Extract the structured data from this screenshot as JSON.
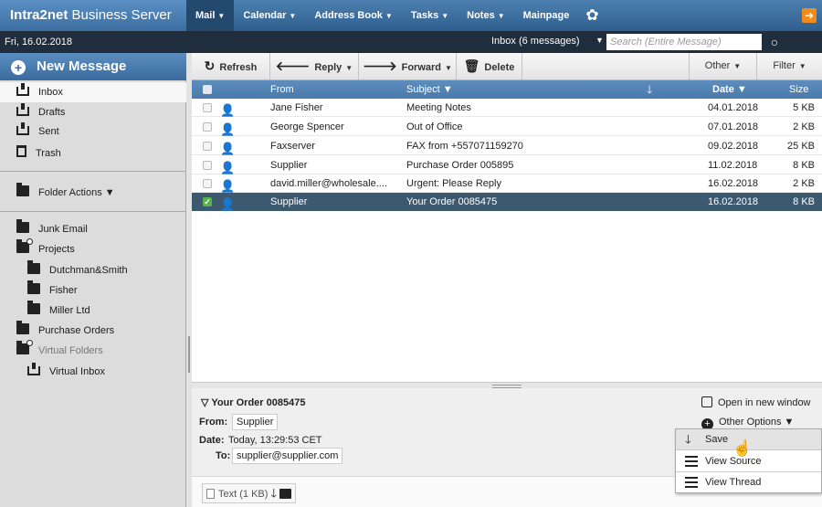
{
  "brand": {
    "bold": "Intra2net",
    "light": " Business Server"
  },
  "nav": {
    "items": [
      {
        "label": "Mail",
        "caret": "▼"
      },
      {
        "label": "Calendar",
        "caret": "▼"
      },
      {
        "label": "Address Book",
        "caret": "▼"
      },
      {
        "label": "Tasks",
        "caret": "▼"
      },
      {
        "label": "Notes",
        "caret": "▼"
      },
      {
        "label": "Mainpage",
        "caret": ""
      }
    ]
  },
  "subbar": {
    "date": "Fri, 16.02.2018",
    "inbox_count": "Inbox (6 messages)",
    "search_placeholder": "Search (Entire Message)"
  },
  "sidebar": {
    "new_message": "New Message",
    "folders": [
      {
        "label": "Inbox"
      },
      {
        "label": "Drafts"
      },
      {
        "label": "Sent"
      },
      {
        "label": "Trash"
      }
    ],
    "folder_actions": "Folder Actions ▼",
    "more": [
      {
        "label": "Junk Email"
      },
      {
        "label": "Projects"
      },
      {
        "label": "Dutchman&Smith"
      },
      {
        "label": "Fisher"
      },
      {
        "label": "Miller Ltd"
      },
      {
        "label": "Purchase Orders"
      },
      {
        "label": "Virtual Folders"
      },
      {
        "label": "Virtual Inbox"
      }
    ]
  },
  "toolbar": {
    "refresh": "Refresh",
    "reply": "Reply",
    "forward": "Forward",
    "delete": "Delete",
    "other": "Other",
    "filter": "Filter"
  },
  "list": {
    "headers": {
      "from": "From",
      "subject": "Subject ▼",
      "date": "Date ▼",
      "size": "Size"
    },
    "rows": [
      {
        "from": "Jane Fisher",
        "subject": "Meeting Notes",
        "date": "04.01.2018",
        "size": "5 KB"
      },
      {
        "from": "George Spencer",
        "subject": "Out of Office",
        "date": "07.01.2018",
        "size": "2 KB"
      },
      {
        "from": "Faxserver",
        "subject": "FAX from +557071159270",
        "date": "09.02.2018",
        "size": "25 KB"
      },
      {
        "from": "Supplier",
        "subject": "Purchase Order 005895",
        "date": "11.02.2018",
        "size": "8 KB"
      },
      {
        "from": "david.miller@wholesale....",
        "subject": "Urgent: Please Reply",
        "date": "16.02.2018",
        "size": "2 KB"
      },
      {
        "from": "Supplier",
        "subject": "Your Order 0085475",
        "date": "16.02.2018",
        "size": "8 KB"
      }
    ]
  },
  "preview": {
    "title": "▽ Your Order 0085475",
    "from_label": "From:",
    "from_value": "Supplier",
    "date_label": "Date:",
    "date_value": "Today, 13:29:53 CET",
    "to_label": "To:",
    "to_value": "supplier@supplier.com",
    "attachment": "Text (1 KB)",
    "open_new_window": "Open in new window",
    "other_options": "Other Options ▼"
  },
  "menu": {
    "items": [
      {
        "label": "Save"
      },
      {
        "label": "View Source"
      },
      {
        "label": "View Thread"
      }
    ]
  },
  "colors": {
    "header_blue": "#3c6ea0",
    "selected_row": "#3d5970",
    "dark_bar": "#1f2d3c",
    "logout_orange": "#f08c1e"
  }
}
